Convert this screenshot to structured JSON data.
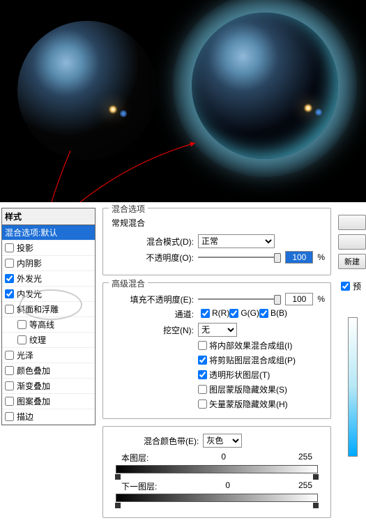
{
  "styles_panel": {
    "header": "样式",
    "items": [
      {
        "label": "混合选项:默认",
        "checked": false,
        "has_checkbox": false,
        "selected": true
      },
      {
        "label": "投影",
        "checked": false,
        "has_checkbox": true
      },
      {
        "label": "内阴影",
        "checked": false,
        "has_checkbox": true
      },
      {
        "label": "外发光",
        "checked": true,
        "has_checkbox": true
      },
      {
        "label": "内发光",
        "checked": true,
        "has_checkbox": true
      },
      {
        "label": "斜面和浮雕",
        "checked": false,
        "has_checkbox": true
      },
      {
        "label": "等高线",
        "checked": false,
        "has_checkbox": true,
        "indent": true
      },
      {
        "label": "纹理",
        "checked": false,
        "has_checkbox": true,
        "indent": true
      },
      {
        "label": "光泽",
        "checked": false,
        "has_checkbox": true
      },
      {
        "label": "颜色叠加",
        "checked": false,
        "has_checkbox": true
      },
      {
        "label": "渐变叠加",
        "checked": false,
        "has_checkbox": true
      },
      {
        "label": "图案叠加",
        "checked": false,
        "has_checkbox": true
      },
      {
        "label": "描边",
        "checked": false,
        "has_checkbox": true
      }
    ]
  },
  "blend_options": {
    "title": "混合选项",
    "general": {
      "heading": "常规混合",
      "mode_label": "混合模式(D):",
      "mode_value": "正常",
      "opacity_label": "不透明度(O):",
      "opacity_value": "100",
      "opacity_unit": "%"
    },
    "advanced": {
      "heading": "高级混合",
      "fill_label": "填充不透明度(E):",
      "fill_value": "100",
      "fill_unit": "%",
      "channel_label": "通道:",
      "channels": [
        {
          "label": "R(R)",
          "checked": true
        },
        {
          "label": "G(G)",
          "checked": true
        },
        {
          "label": "B(B)",
          "checked": true
        }
      ],
      "knockout_label": "挖空(N):",
      "knockout_value": "无",
      "flags": [
        {
          "label": "将内部效果混合成组(I)",
          "checked": false
        },
        {
          "label": "将剪贴图层混合成组(P)",
          "checked": true
        },
        {
          "label": "透明形状图层(T)",
          "checked": true
        },
        {
          "label": "图层蒙版隐藏效果(S)",
          "checked": false
        },
        {
          "label": "矢量蒙版隐藏效果(H)",
          "checked": false
        }
      ]
    },
    "blend_if": {
      "label": "混合颜色带(E):",
      "value": "灰色",
      "this_layer_label": "本图层:",
      "this_low": "0",
      "this_high": "255",
      "under_layer_label": "下一图层:",
      "under_low": "0",
      "under_high": "255"
    }
  },
  "right": {
    "new_style": "新建",
    "preview_label": "预"
  }
}
